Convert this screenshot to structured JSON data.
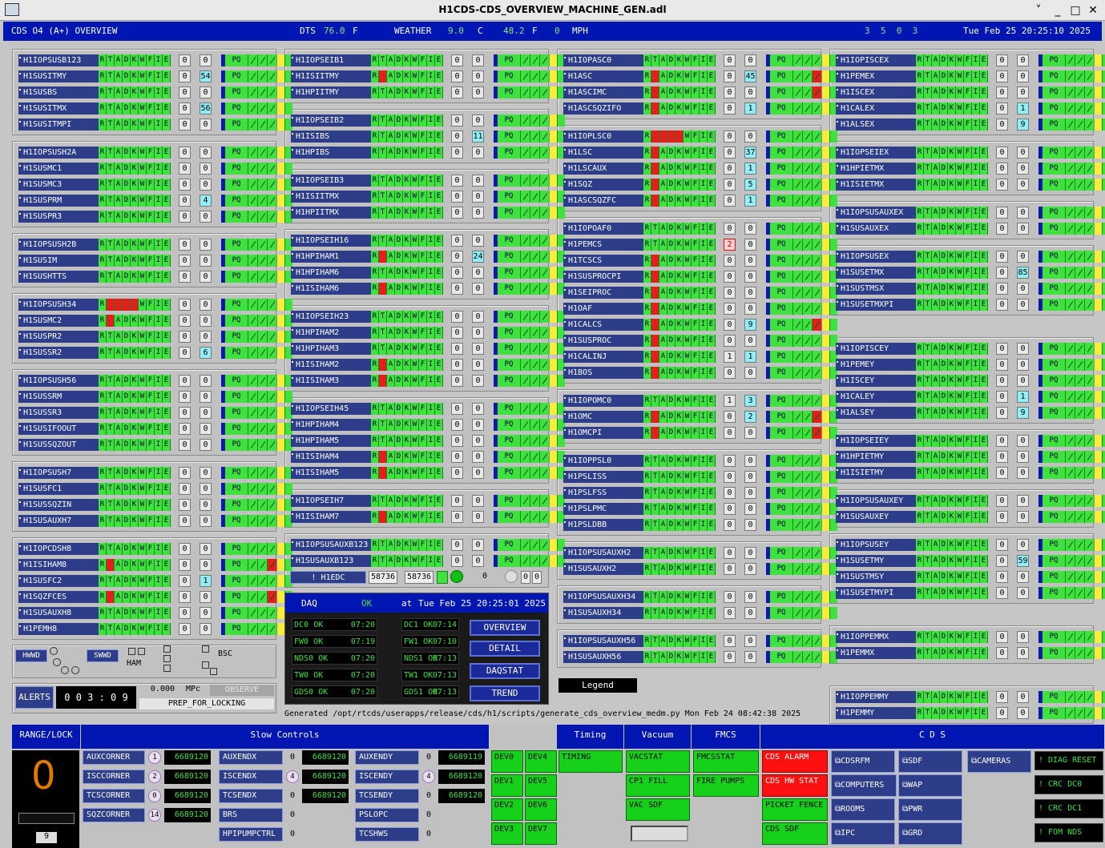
{
  "window": {
    "title": "H1CDS-CDS_OVERVIEW_MACHINE_GEN.adl"
  },
  "topbar": {
    "label": "CDS O4 (A+) OVERVIEW",
    "dts_label": "DTS",
    "dts_value": "76.0",
    "dts_unit": "F",
    "weather_label": "WEATHER",
    "w1": "9.0",
    "w1_unit": "C",
    "w2": "48.2",
    "w2_unit": "F",
    "w3": "0",
    "w3_unit": "MPH",
    "counts": "3  5  0  3",
    "datetime": "Tue Feb 25 20:25:10 2025"
  },
  "stat_letters": [
    "R",
    "T",
    "A",
    "D",
    "K",
    "W",
    "F",
    "I",
    "E"
  ],
  "pq_label": "PQ",
  "col1": [
    {
      "name": "H1IOPSUSB123",
      "c1": "0",
      "c2": "0"
    },
    {
      "name": "H1SUSITMY",
      "c1": "0",
      "c2": "54",
      "cy": true
    },
    {
      "name": "H1SUSBS",
      "c1": "0",
      "c2": "0"
    },
    {
      "name": "H1SUSITMX",
      "c1": "0",
      "c2": "56",
      "cy": true
    },
    {
      "name": "H1SUSITMPI",
      "c1": "0",
      "c2": "0"
    },
    {
      "name": "H1IOPSUSH2A",
      "c1": "0",
      "c2": "0"
    },
    {
      "name": "H1SUSMC1",
      "c1": "0",
      "c2": "0"
    },
    {
      "name": "H1SUSMC3",
      "c1": "0",
      "c2": "0"
    },
    {
      "name": "H1SUSPRM",
      "c1": "0",
      "c2": "4",
      "cy": true
    },
    {
      "name": "H1SUSPR3",
      "c1": "0",
      "c2": "0"
    },
    {
      "name": "H1IOPSUSH2B",
      "c1": "0",
      "c2": "0"
    },
    {
      "name": "H1SUSIM",
      "c1": "0",
      "c2": "0"
    },
    {
      "name": "H1SUSHTTS",
      "c1": "0",
      "c2": "0"
    },
    {
      "name": "H1IOPSUSH34",
      "c1": "0",
      "c2": "0",
      "red": [
        1,
        2,
        3,
        4
      ]
    },
    {
      "name": "H1SUSMC2",
      "c1": "0",
      "c2": "0",
      "red": [
        1
      ]
    },
    {
      "name": "H1SUSPR2",
      "c1": "0",
      "c2": "0"
    },
    {
      "name": "H1SUSSR2",
      "c1": "0",
      "c2": "6",
      "cy": true
    },
    {
      "name": "H1IOPSUSH56",
      "c1": "0",
      "c2": "0"
    },
    {
      "name": "H1SUSSRM",
      "c1": "0",
      "c2": "0"
    },
    {
      "name": "H1SUSSR3",
      "c1": "0",
      "c2": "0"
    },
    {
      "name": "H1SUSIFOOUT",
      "c1": "0",
      "c2": "0"
    },
    {
      "name": "H1SUSSQZOUT",
      "c1": "0",
      "c2": "0"
    },
    {
      "name": "H1IOPSUSH7",
      "c1": "0",
      "c2": "0"
    },
    {
      "name": "H1SUSFC1",
      "c1": "0",
      "c2": "0"
    },
    {
      "name": "H1SUSSQZIN",
      "c1": "0",
      "c2": "0"
    },
    {
      "name": "H1SUSAUXH7",
      "c1": "0",
      "c2": "0"
    },
    {
      "name": "H1IOPCDSH8",
      "c1": "0",
      "c2": "0"
    },
    {
      "name": "H1ISIHAM8",
      "c1": "0",
      "c2": "0",
      "red": [
        1
      ],
      "pqred": true
    },
    {
      "name": "H1SUSFC2",
      "c1": "0",
      "c2": "1",
      "cy": true
    },
    {
      "name": "H1SQZFCES",
      "c1": "0",
      "c2": "0",
      "red": [
        1
      ],
      "pqred": true
    },
    {
      "name": "H1SUSAUXH8",
      "c1": "0",
      "c2": "0"
    },
    {
      "name": "H1PEMH8",
      "c1": "0",
      "c2": "0"
    }
  ],
  "col2": [
    {
      "name": "H1IOPSEIB1",
      "c1": "0",
      "c2": "0"
    },
    {
      "name": "H1ISIITMY",
      "c1": "0",
      "c2": "0",
      "red": [
        1
      ]
    },
    {
      "name": "H1HPIITMY",
      "c1": "0",
      "c2": "0"
    },
    {
      "name": "H1IOPSEIB2",
      "c1": "0",
      "c2": "0"
    },
    {
      "name": "H1ISIBS",
      "c1": "0",
      "c2": "11",
      "cy": true
    },
    {
      "name": "H1HPIBS",
      "c1": "0",
      "c2": "0"
    },
    {
      "name": "H1IOPSEIB3",
      "c1": "0",
      "c2": "0"
    },
    {
      "name": "H1ISIITMX",
      "c1": "0",
      "c2": "0"
    },
    {
      "name": "H1HPIITMX",
      "c1": "0",
      "c2": "0"
    },
    {
      "name": "H1IOPSEIH16",
      "c1": "0",
      "c2": "0"
    },
    {
      "name": "H1HPIHAM1",
      "c1": "0",
      "c2": "24",
      "cy": true,
      "red": [
        1
      ]
    },
    {
      "name": "H1HPIHAM6",
      "c1": "0",
      "c2": "0"
    },
    {
      "name": "H1ISIHAM6",
      "c1": "0",
      "c2": "0",
      "red": [
        1
      ]
    },
    {
      "name": "H1IOPSEIH23",
      "c1": "0",
      "c2": "0"
    },
    {
      "name": "H1HPIHAM2",
      "c1": "0",
      "c2": "0"
    },
    {
      "name": "H1HPIHAM3",
      "c1": "0",
      "c2": "0"
    },
    {
      "name": "H1ISIHAM2",
      "c1": "0",
      "c2": "0",
      "red": [
        1
      ]
    },
    {
      "name": "H1ISIHAM3",
      "c1": "0",
      "c2": "0",
      "red": [
        1
      ]
    },
    {
      "name": "H1IOPSEIH45",
      "c1": "0",
      "c2": "0"
    },
    {
      "name": "H1HPIHAM4",
      "c1": "0",
      "c2": "0"
    },
    {
      "name": "H1HPIHAM5",
      "c1": "0",
      "c2": "0"
    },
    {
      "name": "H1ISIHAM4",
      "c1": "0",
      "c2": "0",
      "red": [
        1
      ]
    },
    {
      "name": "H1ISIHAM5",
      "c1": "0",
      "c2": "0",
      "red": [
        1
      ]
    },
    {
      "name": "H1IOPSEIH7",
      "c1": "0",
      "c2": "0"
    },
    {
      "name": "H1ISIHAM7",
      "c1": "0",
      "c2": "0",
      "red": [
        1
      ]
    },
    {
      "name": "H1IOPSUSAUXB123",
      "c1": "0",
      "c2": "0"
    },
    {
      "name": "H1SUSAUXB123",
      "c1": "0",
      "c2": "0"
    }
  ],
  "col3": [
    {
      "name": "H1IOPASC0",
      "c1": "0",
      "c2": "0"
    },
    {
      "name": "H1ASC",
      "c1": "0",
      "c2": "45",
      "cy": true,
      "red": [
        1
      ],
      "pqred": true
    },
    {
      "name": "H1ASCIMC",
      "c1": "0",
      "c2": "0",
      "red": [
        1
      ],
      "pqred": true
    },
    {
      "name": "H1ASCSQZIFO",
      "c1": "0",
      "c2": "1",
      "cy": true,
      "red": [
        1
      ]
    },
    {
      "name": "H1IOPLSC0",
      "c1": "0",
      "c2": "0",
      "red": [
        1,
        2,
        3,
        4
      ]
    },
    {
      "name": "H1LSC",
      "c1": "0",
      "c2": "37",
      "cy": true,
      "red": [
        1
      ]
    },
    {
      "name": "H1LSCAUX",
      "c1": "0",
      "c2": "1",
      "cy": true,
      "red": [
        1
      ]
    },
    {
      "name": "H1SQZ",
      "c1": "0",
      "c2": "5",
      "cy": true,
      "red": [
        1
      ]
    },
    {
      "name": "H1ASCSQZFC",
      "c1": "0",
      "c2": "1",
      "cy": true,
      "red": [
        1
      ]
    },
    {
      "name": "H1IOPOAF0",
      "c1": "0",
      "c2": "0"
    },
    {
      "name": "H1PEMCS",
      "c1": "2",
      "c2": "0",
      "re": true
    },
    {
      "name": "H1TCSCS",
      "c1": "0",
      "c2": "0",
      "red": [
        1
      ]
    },
    {
      "name": "H1SUSPROCPI",
      "c1": "0",
      "c2": "0",
      "red": [
        1
      ]
    },
    {
      "name": "H1SEIPROC",
      "c1": "0",
      "c2": "0",
      "red": [
        1
      ]
    },
    {
      "name": "H1OAF",
      "c1": "0",
      "c2": "0",
      "red": [
        1
      ]
    },
    {
      "name": "H1CALCS",
      "c1": "0",
      "c2": "9",
      "cy": true,
      "red": [
        1
      ],
      "pqred": true
    },
    {
      "name": "H1SUSPROC",
      "c1": "0",
      "c2": "0",
      "red": [
        1
      ]
    },
    {
      "name": "H1CALINJ",
      "c1": "1",
      "c2": "1",
      "cy": true,
      "red": [
        1
      ]
    },
    {
      "name": "H1BOS",
      "c1": "0",
      "c2": "0",
      "red": [
        1
      ]
    },
    {
      "name": "H1IOPOMC0",
      "c1": "1",
      "c2": "3",
      "cy": true
    },
    {
      "name": "H1OMC",
      "c1": "0",
      "c2": "2",
      "cy": true,
      "red": [
        1
      ],
      "pqred": true
    },
    {
      "name": "H1OMCPI",
      "c1": "0",
      "c2": "0",
      "red": [
        1
      ],
      "pqred": true
    },
    {
      "name": "H1IOPPSL0",
      "c1": "0",
      "c2": "0"
    },
    {
      "name": "H1PSLISS",
      "c1": "0",
      "c2": "0"
    },
    {
      "name": "H1PSLFSS",
      "c1": "0",
      "c2": "0"
    },
    {
      "name": "H1PSLPMC",
      "c1": "0",
      "c2": "0"
    },
    {
      "name": "H1PSLDBB",
      "c1": "0",
      "c2": "0"
    },
    {
      "name": "H1IOPSUSAUXH2",
      "c1": "0",
      "c2": "0"
    },
    {
      "name": "H1SUSAUXH2",
      "c1": "0",
      "c2": "0"
    },
    {
      "name": "H1IOPSUSAUXH34",
      "c1": "0",
      "c2": "0"
    },
    {
      "name": "H1SUSAUXH34",
      "c1": "0",
      "c2": "0"
    },
    {
      "name": "H1IOPSUSAUXH56",
      "c1": "0",
      "c2": "0"
    },
    {
      "name": "H1SUSAUXH56",
      "c1": "0",
      "c2": "0"
    }
  ],
  "col4": [
    {
      "name": "H1IOPISCEX",
      "c1": "0",
      "c2": "0"
    },
    {
      "name": "H1PEMEX",
      "c1": "0",
      "c2": "0"
    },
    {
      "name": "H1ISCEX",
      "c1": "0",
      "c2": "0"
    },
    {
      "name": "H1CALEX",
      "c1": "0",
      "c2": "1",
      "cy": true
    },
    {
      "name": "H1ALSEX",
      "c1": "0",
      "c2": "9",
      "cy": true
    },
    {
      "name": "H1IOPSEIEX",
      "c1": "0",
      "c2": "0"
    },
    {
      "name": "H1HPIETMX",
      "c1": "0",
      "c2": "0"
    },
    {
      "name": "H1ISIETMX",
      "c1": "0",
      "c2": "0"
    },
    {
      "name": "H1IOPSUSAUXEX",
      "c1": "0",
      "c2": "0"
    },
    {
      "name": "H1SUSAUXEX",
      "c1": "0",
      "c2": "0"
    },
    {
      "name": "H1IOPSUSEX",
      "c1": "0",
      "c2": "0"
    },
    {
      "name": "H1SUSETMX",
      "c1": "0",
      "c2": "85",
      "cy": true
    },
    {
      "name": "H1SUSTMSX",
      "c1": "0",
      "c2": "0"
    },
    {
      "name": "H1SUSETMXPI",
      "c1": "0",
      "c2": "0"
    },
    {
      "name": "H1IOPISCEY",
      "c1": "0",
      "c2": "0"
    },
    {
      "name": "H1PEMEY",
      "c1": "0",
      "c2": "0"
    },
    {
      "name": "H1ISCEY",
      "c1": "0",
      "c2": "0"
    },
    {
      "name": "H1CALEY",
      "c1": "0",
      "c2": "1",
      "cy": true
    },
    {
      "name": "H1ALSEY",
      "c1": "0",
      "c2": "9",
      "cy": true
    },
    {
      "name": "H1IOPSEIEY",
      "c1": "0",
      "c2": "0"
    },
    {
      "name": "H1HPIETMY",
      "c1": "0",
      "c2": "0"
    },
    {
      "name": "H1ISIETMY",
      "c1": "0",
      "c2": "0"
    },
    {
      "name": "H1IOPSUSAUXEY",
      "c1": "0",
      "c2": "0"
    },
    {
      "name": "H1SUSAUXEY",
      "c1": "0",
      "c2": "0"
    },
    {
      "name": "H1IOPSUSEY",
      "c1": "0",
      "c2": "0"
    },
    {
      "name": "H1SUSETMY",
      "c1": "0",
      "c2": "59",
      "cy": true
    },
    {
      "name": "H1SUSTMSY",
      "c1": "0",
      "c2": "0"
    },
    {
      "name": "H1SUSETMYPI",
      "c1": "0",
      "c2": "0"
    },
    {
      "name": "H1IOPPEMMX",
      "c1": "0",
      "c2": "0"
    },
    {
      "name": "H1PEMMX",
      "c1": "0",
      "c2": "0"
    },
    {
      "name": "H1IOPPEMMY",
      "c1": "0",
      "c2": "0"
    },
    {
      "name": "H1PEMMY",
      "c1": "0",
      "c2": "0"
    }
  ],
  "edc": {
    "label": "! H1EDC",
    "v1": "58736",
    "v2": "58736",
    "v3": "0",
    "v4": "0",
    "v5": "0"
  },
  "daq": {
    "label": "DAQ",
    "status": "OK",
    "at": "at",
    "time": "Tue Feb 25 20:25:01 2025",
    "cells": [
      {
        "l": "DC0 OK",
        "t": "07:20"
      },
      {
        "l": "DC1 OK",
        "t": "07:14"
      },
      {
        "l": "FW0 OK",
        "t": "07:19"
      },
      {
        "l": "FW1 OK",
        "t": "07:10"
      },
      {
        "l": "NDS0 OK",
        "t": "07:20"
      },
      {
        "l": "NDS1 OK",
        "t": "07:13"
      },
      {
        "l": "TW0 OK",
        "t": "07:20"
      },
      {
        "l": "TW1 OK",
        "t": "07:13"
      },
      {
        "l": "GDS0 OK",
        "t": "07:20"
      },
      {
        "l": "GDS1 OK",
        "t": "07:13"
      }
    ],
    "buttons": [
      "OVERVIEW",
      "DETAIL",
      "DAQSTAT",
      "TREND"
    ]
  },
  "misc": {
    "hwwd": "HWWD",
    "swwd": "SWWD",
    "ham": "HAM",
    "bsc": "BSC",
    "alerts": "ALERTS",
    "timer": "0 0 3 : 0 9",
    "mpc_value": "0.000",
    "mpc_unit": "MPc",
    "observe": "OBSERVE",
    "guardian_state": "PREP_FOR_LOCKING",
    "legend": "Legend",
    "generated": "Generated /opt/rtcds/userapps/release/cds/h1/scripts/generate_cds_overview_medm.py Mon Feb 24 08:42:38 2025"
  },
  "bottom": {
    "range_lock": "RANGE/LOCK",
    "range_digit": "0",
    "range_small": "9",
    "slow_controls": "Slow Controls",
    "timing_hdr": "Timing",
    "vacuum_hdr": "Vacuum",
    "fmcs_hdr": "FMCS",
    "cds_hdr": "C D S",
    "slow_rows": [
      {
        "a": "AUXCORNER",
        "an": "1",
        "av": "6689120",
        "b": "AUXENDX",
        "bn": "0",
        "bv": "6689120",
        "c": "AUXENDY",
        "cn": "0",
        "cv": "6689119"
      },
      {
        "a": "ISCCORNER",
        "an": "2",
        "av": "6689120",
        "b": "ISCENDX",
        "bn": "4",
        "bv": "6689120",
        "c": "ISCENDY",
        "cn": "4",
        "cv": "6689120"
      },
      {
        "a": "TCSCORNER",
        "an": "0",
        "av": "6689120",
        "b": "TCSENDX",
        "bn": "0",
        "bv": "6689120",
        "c": "TCSENDY",
        "cn": "0",
        "cv": "6689120"
      },
      {
        "a": "SQZCORNER",
        "an": "14",
        "av": "6689120",
        "b": "BRS",
        "bn": "0",
        "bv": "",
        "c": "PSLOPC",
        "cn": "0",
        "cv": ""
      },
      {
        "a": "",
        "an": "",
        "av": "",
        "b": "HPIPUMPCTRL",
        "bn": "0",
        "bv": "",
        "c": "TCSHWS",
        "cn": "0",
        "cv": ""
      }
    ],
    "dev": [
      "DEV0",
      "DEV4",
      "DEV1",
      "DEV5",
      "DEV2",
      "DEV6",
      "DEV3",
      "DEV7"
    ],
    "timing": "TIMING",
    "vacuum": [
      "VACSTAT",
      "CP1 FILL",
      "VAC SDF"
    ],
    "fmcs": [
      "FMCSSTAT",
      "FIRE PUMPS"
    ],
    "cds_status": [
      "CDS ALARM",
      "CDS HW STAT",
      "PICKET FENCE",
      "CDS SDF"
    ],
    "cds_btns": [
      "CDSRFM",
      "SDF",
      "CAMERAS",
      "COMPUTERS",
      "WAP",
      "ROOMS",
      "PWR",
      "IPC",
      "GRD"
    ],
    "right_btns": [
      "! DIAG RESET",
      "! CRC DC0",
      "! CRC DC1",
      "! FOM NDS"
    ]
  }
}
